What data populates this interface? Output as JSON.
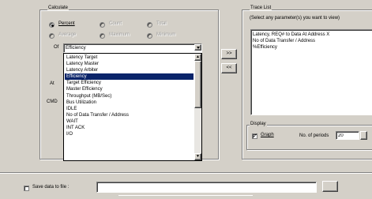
{
  "calculate": {
    "title": "Calculate",
    "options": [
      {
        "label": "Percent",
        "selected": true,
        "enabled": true
      },
      {
        "label": "Count",
        "selected": false,
        "enabled": false
      },
      {
        "label": "Total",
        "selected": false,
        "enabled": false
      },
      {
        "label": "Average",
        "selected": false,
        "enabled": false
      },
      {
        "label": "Maximum",
        "selected": false,
        "enabled": false
      },
      {
        "label": "Minimum",
        "selected": false,
        "enabled": false
      }
    ]
  },
  "dropdown": {
    "label": "Of",
    "value": "Efficiency",
    "options": [
      "Latency Target",
      "Latency Master",
      "Latency Arbiter",
      "Efficiency",
      "Target Efficiency",
      "Master Efficiency",
      "Throughput (MB/Sec)",
      "Bus Utilization",
      "IDLE",
      "No of Data Transfer / Address",
      "WAIT",
      "INT ACK",
      "I/O"
    ],
    "selected_index": 3
  },
  "side_labels": {
    "at": "At",
    "cmd": "CMD"
  },
  "buttons": {
    "add": ">>",
    "remove": "<<"
  },
  "trace_list": {
    "title": "Trace List",
    "hint": "(Select any parameter(s) you want to view)",
    "items": [
      "Latency, REQ# to Data At Address X",
      "No of Data Transfer / Address",
      "%Efficiency"
    ]
  },
  "display": {
    "title": "Display",
    "graph_label": "Graph",
    "graph_checked": true,
    "periods_label": "No. of periods",
    "periods_value": "20"
  },
  "save": {
    "label": "Save data to file :",
    "checked": false,
    "path": ""
  }
}
